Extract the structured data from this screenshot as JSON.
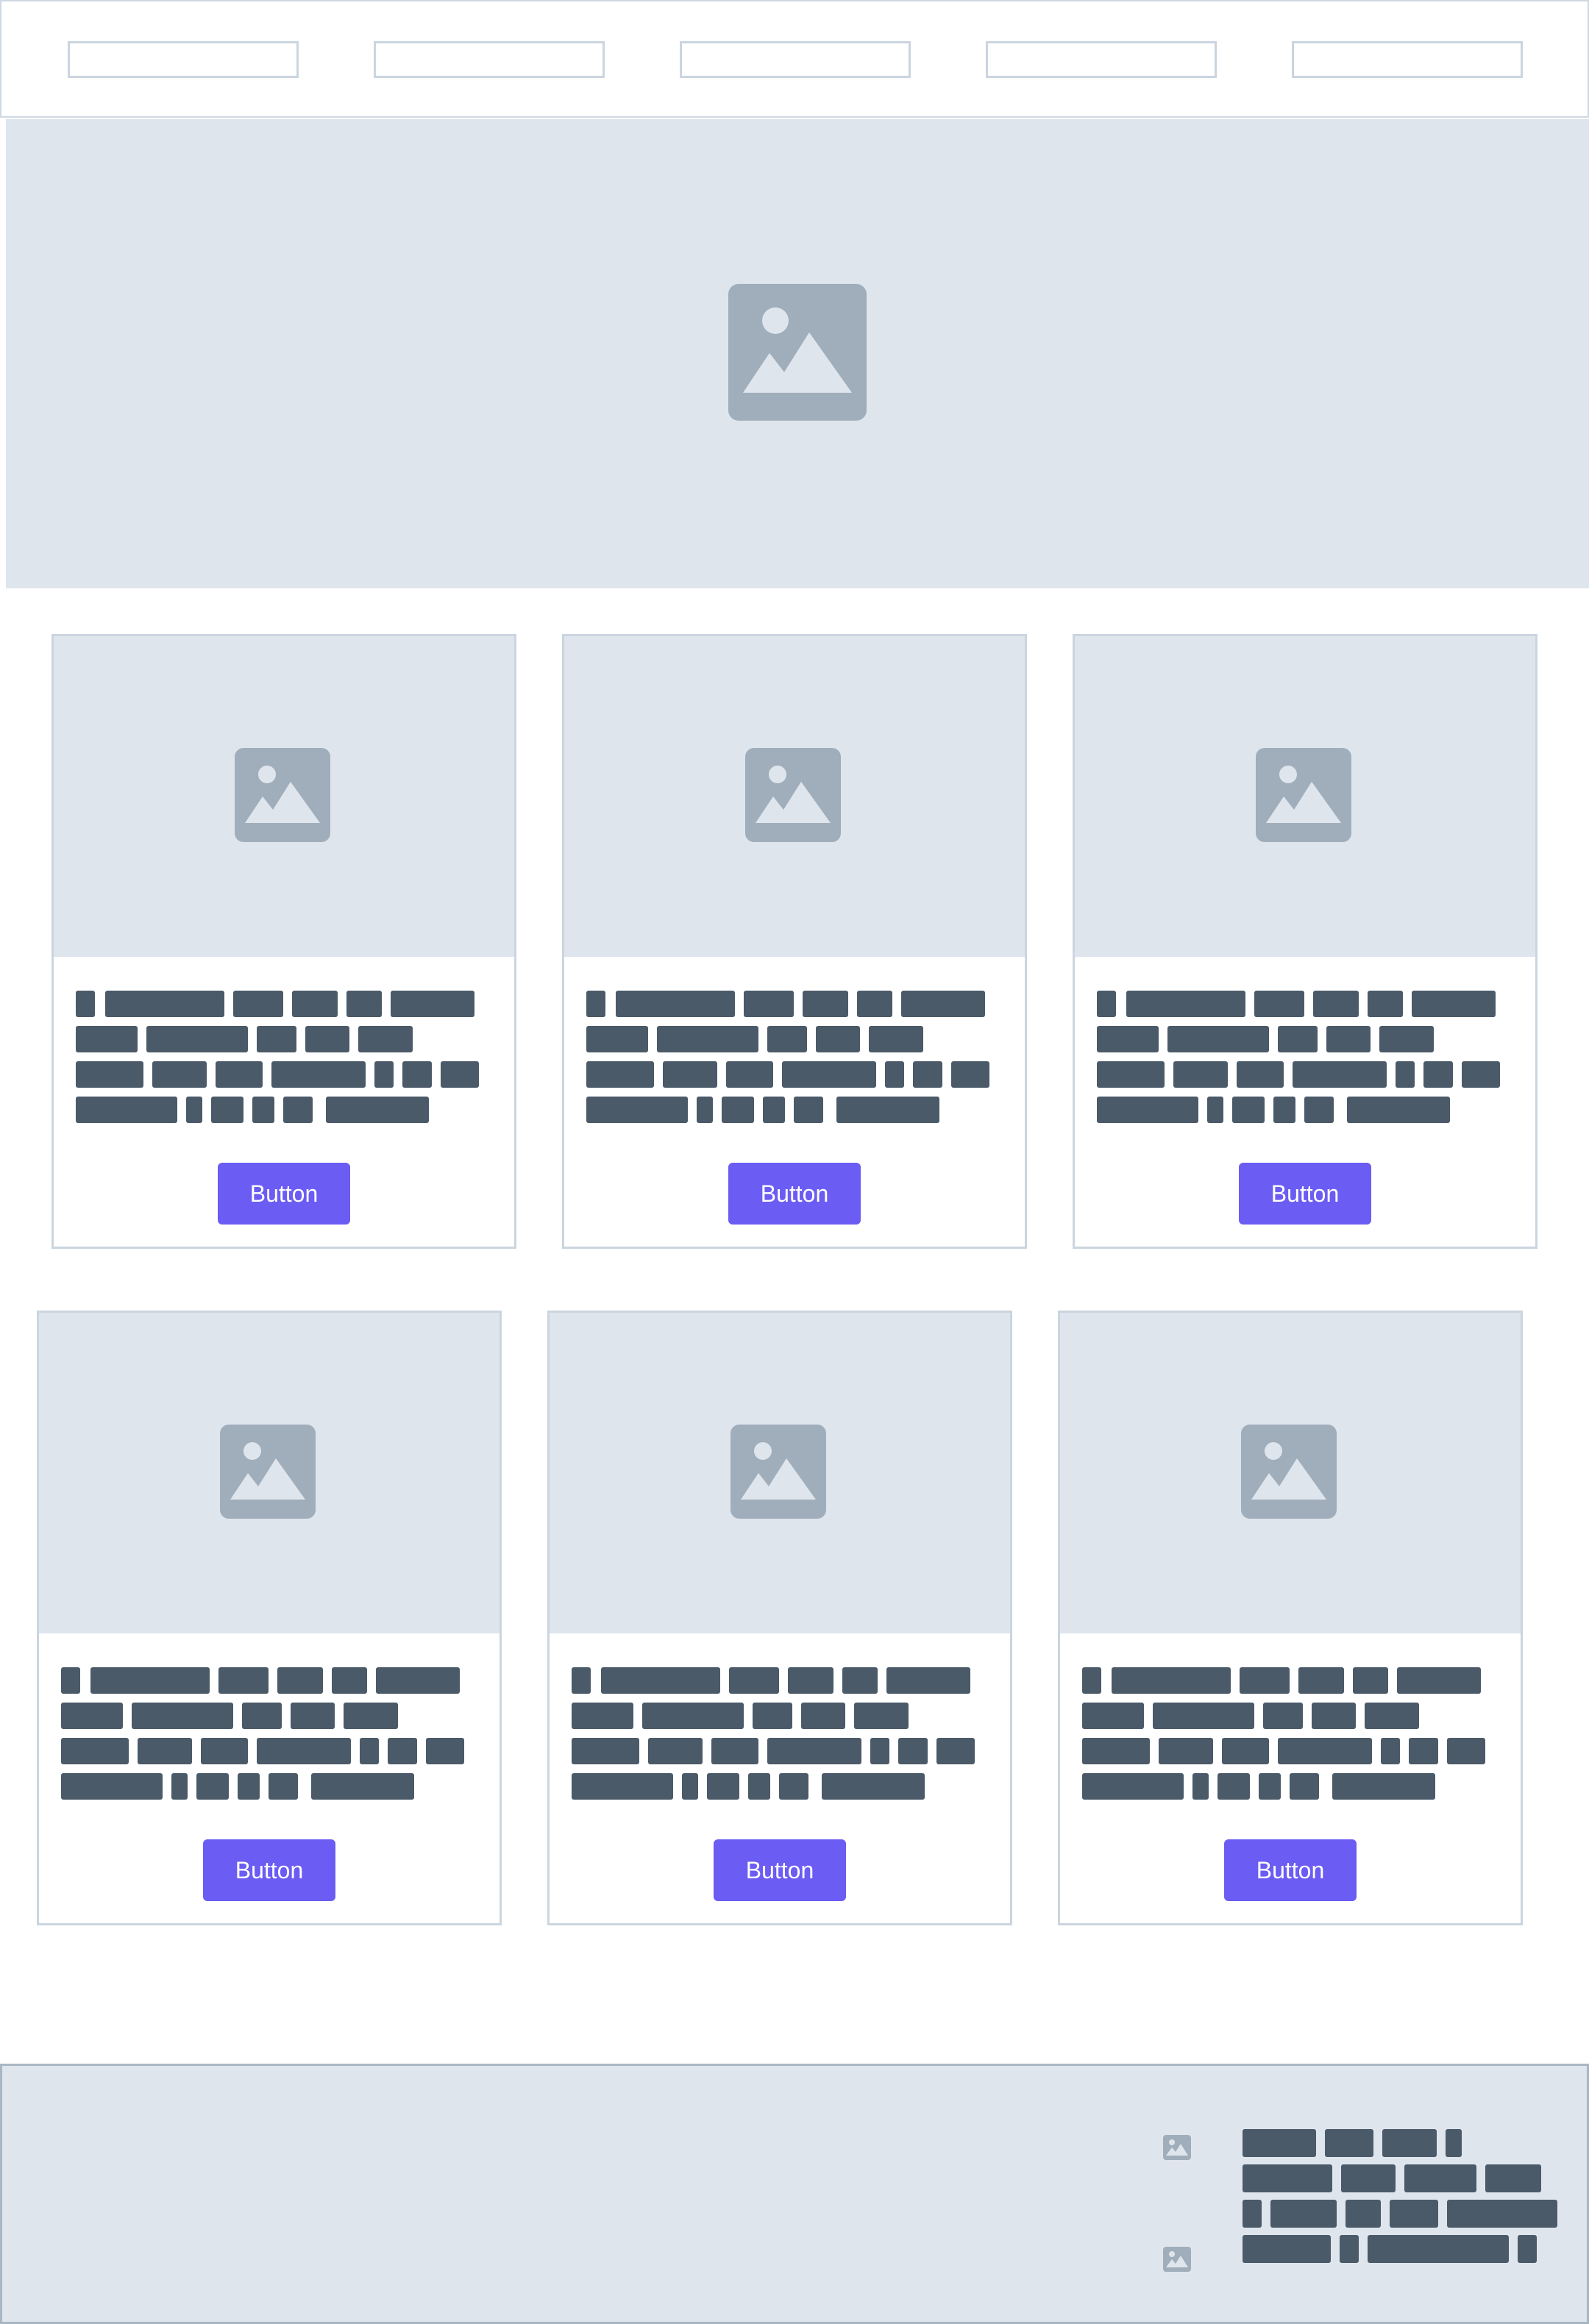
{
  "nav": {
    "items": [
      "",
      "",
      "",
      "",
      ""
    ]
  },
  "hero": {
    "icon": "image-placeholder-icon"
  },
  "cards": [
    {
      "button_label": "Button",
      "icon": "image-placeholder-icon"
    },
    {
      "button_label": "Button",
      "icon": "image-placeholder-icon"
    },
    {
      "button_label": "Button",
      "icon": "image-placeholder-icon"
    },
    {
      "button_label": "Button",
      "icon": "image-placeholder-icon"
    },
    {
      "button_label": "Button",
      "icon": "image-placeholder-icon"
    },
    {
      "button_label": "Button",
      "icon": "image-placeholder-icon"
    }
  ],
  "footer": {
    "icons": [
      "image-placeholder-icon",
      "image-placeholder-icon"
    ]
  },
  "colors": {
    "accent": "#6b5cf3",
    "placeholder_bg": "#dfe5ed",
    "icon_gray": "#a0aebb",
    "text_block": "#4b5a68",
    "border": "#cbd5e0"
  }
}
